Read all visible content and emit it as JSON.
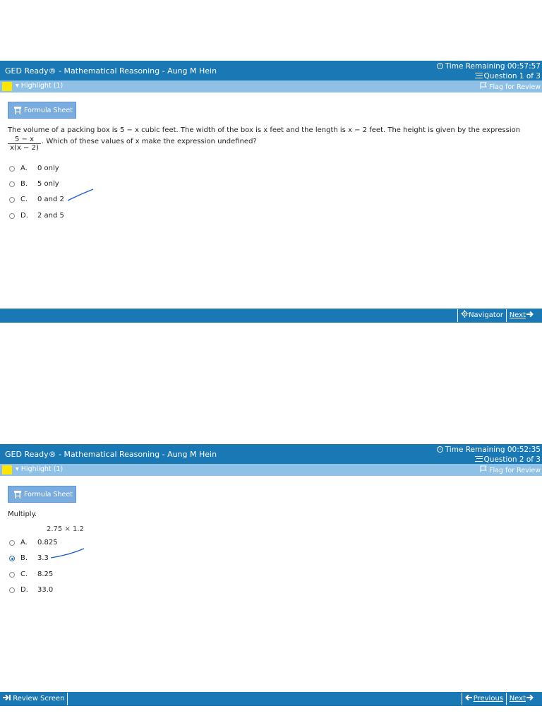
{
  "screens": [
    {
      "title": "GED Ready® - Mathematical Reasoning - Aung M Hein",
      "time_remaining": "Time Remaining 00:57:57",
      "question_counter": "Question 1 of 3",
      "highlight_label": "▾ Highlight (1)",
      "flag_label": "Flag for Review",
      "formula_label": "Formula Sheet",
      "question_line1": "The volume of a packing box is 5 − x cubic feet. The width of the box is x feet and the length is x − 2 feet. The height is given by the expression",
      "fraction_numerator": "5 − x",
      "fraction_denominator": "x(x − 2)",
      "question_line2": ". Which of these values of x make the expression undefined?",
      "options": [
        {
          "letter": "A.",
          "text": "0 only",
          "selected": false
        },
        {
          "letter": "B.",
          "text": "5 only",
          "selected": false
        },
        {
          "letter": "C.",
          "text": "0 and 2",
          "selected": false
        },
        {
          "letter": "D.",
          "text": "2 and 5",
          "selected": false
        }
      ],
      "navigator_label": "Navigator",
      "next_label": "Next"
    },
    {
      "title": "GED Ready® - Mathematical Reasoning - Aung M Hein",
      "time_remaining": "Time Remaining 00:52:35",
      "question_counter": "Question 2 of 3",
      "highlight_label": "▾ Highlight (1)",
      "flag_label": "Flag for Review",
      "formula_label": "Formula Sheet",
      "question_text": "Multiply.",
      "expression": "2.75 × 1.2",
      "options": [
        {
          "letter": "A.",
          "text": "0.825",
          "selected": false
        },
        {
          "letter": "B.",
          "text": "3.3",
          "selected": true
        },
        {
          "letter": "C.",
          "text": "8.25",
          "selected": false
        },
        {
          "letter": "D.",
          "text": "33.0",
          "selected": false
        }
      ],
      "review_label": "Review Screen",
      "previous_label": "Previous",
      "next_label": "Next"
    }
  ],
  "colors": {
    "title_bar": "#1a78b4",
    "toolbar": "#8fc0e6",
    "highlight_swatch": "#ffe600",
    "button": "#7aacdf",
    "pen_mark": "#1f5fc9"
  },
  "icons": [
    "clock-icon",
    "question-list-icon",
    "flag-icon",
    "stool-icon",
    "navigator-icon",
    "arrow-right-icon",
    "arrow-left-icon",
    "review-arrow-icon"
  ]
}
